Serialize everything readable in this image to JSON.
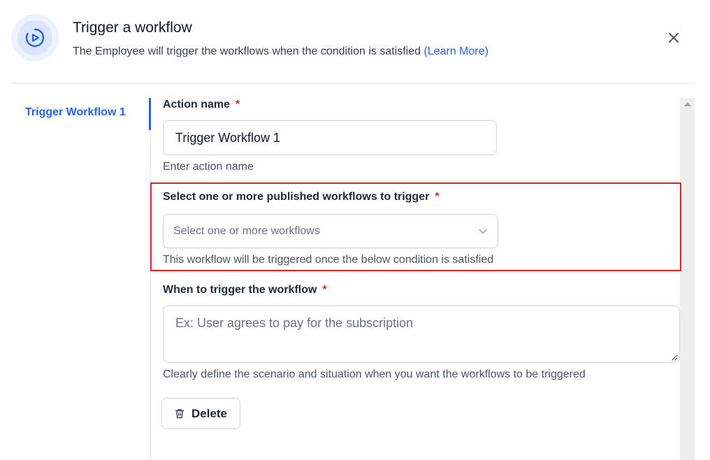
{
  "header": {
    "title": "Trigger a workflow",
    "subtitle": "The Employee will trigger the workflows when the condition is satisfied",
    "learn_more": "(Learn More)",
    "icon": "play-circle-icon",
    "close_icon": "close-icon"
  },
  "sidebar": {
    "items": [
      {
        "label": "Trigger Workflow 1",
        "active": true
      }
    ]
  },
  "form": {
    "action_name": {
      "label": "Action name",
      "required_mark": "*",
      "value": "Trigger Workflow 1",
      "help": "Enter action name"
    },
    "workflows": {
      "label": "Select one or more published workflows to trigger",
      "required_mark": "*",
      "placeholder": "Select one or more workflows",
      "help": "This workflow will be triggered once the below condition is satisfied"
    },
    "trigger_condition": {
      "label": "When to trigger the workflow",
      "required_mark": "*",
      "placeholder": "Ex: User agrees to pay for the subscription",
      "help": "Clearly define the scenario and situation when you want the workflows to be triggered"
    },
    "delete_button": {
      "label": "Delete",
      "icon": "trash-icon"
    }
  },
  "colors": {
    "accent": "#2563eb",
    "required": "#dc2626",
    "highlight_border": "#dc2626"
  }
}
